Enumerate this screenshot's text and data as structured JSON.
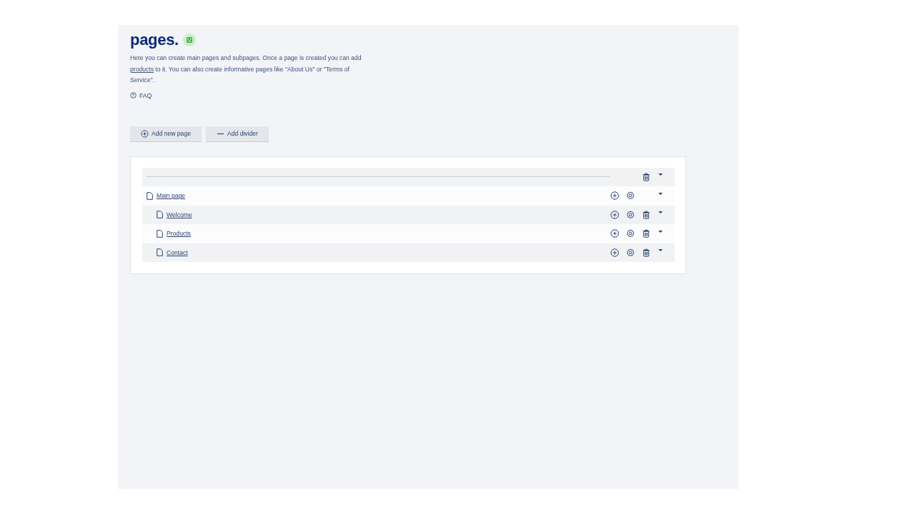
{
  "header": {
    "title": "pages.",
    "description_before": "Here you can create main pages and subpages. Once a page is created you can add ",
    "description_link": "products",
    "description_after": " to it. You can also create informative pages like \"About Us\" or \"Terms of Service\".",
    "faq_link": "FAQ"
  },
  "toolbar": {
    "buttons": [
      {
        "kind": "add",
        "label": "Add new page"
      },
      {
        "kind": "divider",
        "label": "Add divider"
      }
    ]
  },
  "tree": [
    {
      "kind": "divider",
      "deletable": true
    },
    {
      "kind": "page",
      "label": "Main page",
      "deletable": false,
      "children": [
        {
          "kind": "page",
          "label": "Welcome",
          "deletable": true
        },
        {
          "kind": "page",
          "label": "Products",
          "deletable": true
        },
        {
          "kind": "page",
          "label": "Contact",
          "deletable": true
        }
      ]
    }
  ]
}
